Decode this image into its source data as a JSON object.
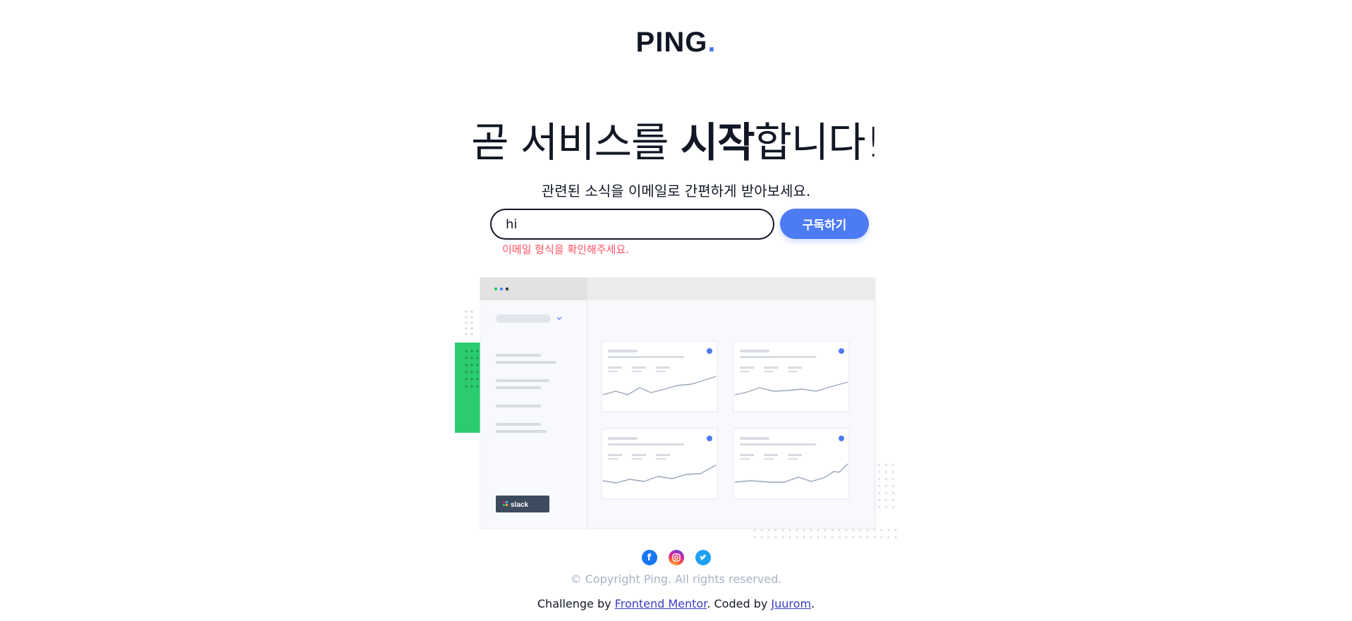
{
  "logo": {
    "text": "PING",
    "dot": "."
  },
  "headline": {
    "part1": "곧 서비스를 ",
    "bold": "시작",
    "part2": "합니다!"
  },
  "subtitle": "관련된 소식을 이메일로 간편하게 받아보세요.",
  "form": {
    "email_value": "hi",
    "button_label": "구독하기",
    "error": "이메일 형식을 확인해주세요."
  },
  "illustration": {
    "brand_label": "slack"
  },
  "social": [
    "facebook-icon",
    "instagram-icon",
    "twitter-icon"
  ],
  "footer": {
    "copyright": "© Copyright Ping. All rights reserved.",
    "credit_prefix": "Challenge by ",
    "credit_link1": "Frontend Mentor",
    "credit_mid": ". Coded by ",
    "credit_link2": "Juurom",
    "credit_suffix": "."
  },
  "colors": {
    "accent": "#4c7bf3",
    "error": "#ff5263",
    "text": "#121725",
    "muted": "#a9b3c5"
  }
}
